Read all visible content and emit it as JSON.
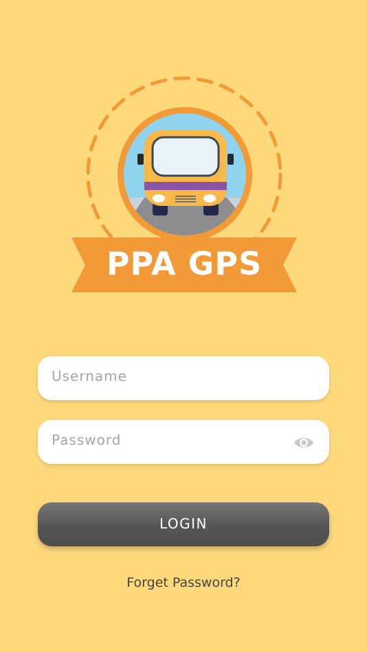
{
  "app": {
    "logo_text": "PPA GPS"
  },
  "login_form": {
    "username_placeholder": "Username",
    "password_placeholder": "Password",
    "password_toggle_icon": "eye-icon",
    "login_label": "LOGIN",
    "forget_password_label": "Forget Password?"
  },
  "colors": {
    "background": "#FED97C",
    "accent_orange": "#F29A38",
    "bus_yellow": "#F8B84A",
    "bus_stripe": "#8A53A3",
    "button_dark": "#555555"
  }
}
